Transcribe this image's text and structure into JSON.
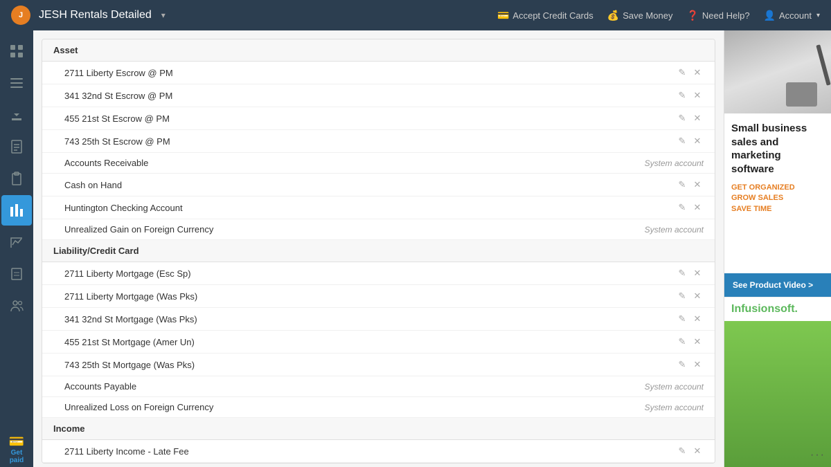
{
  "topnav": {
    "logo_text": "J",
    "title": "JESH Rentals Detailed",
    "dropdown_symbol": "▾",
    "actions": [
      {
        "id": "accept-credit",
        "icon": "💳",
        "label": "Accept Credit Cards"
      },
      {
        "id": "save-money",
        "icon": "💰",
        "label": "Save Money"
      },
      {
        "id": "need-help",
        "icon": "❓",
        "label": "Need Help?"
      },
      {
        "id": "account",
        "icon": "👤",
        "label": "Account",
        "has_dropdown": true
      }
    ]
  },
  "sidebar": {
    "items": [
      {
        "id": "dashboard",
        "icon": "grid",
        "active": false
      },
      {
        "id": "list",
        "icon": "list",
        "active": false
      },
      {
        "id": "download",
        "icon": "download",
        "active": false
      },
      {
        "id": "document",
        "icon": "document",
        "active": false
      },
      {
        "id": "clipboard",
        "icon": "clipboard",
        "active": false
      },
      {
        "id": "chart-active",
        "icon": "chart",
        "active": true
      },
      {
        "id": "bar-chart",
        "icon": "bar",
        "active": false
      },
      {
        "id": "report",
        "icon": "report",
        "active": false
      },
      {
        "id": "people",
        "icon": "people",
        "active": false
      }
    ],
    "get_paid_label": "Get\npaid"
  },
  "sections": [
    {
      "id": "asset",
      "header": "Asset",
      "rows": [
        {
          "id": "r1",
          "name": "2711 Liberty Escrow @ PM",
          "type": "editable"
        },
        {
          "id": "r2",
          "name": "341 32nd St Escrow @ PM",
          "type": "editable"
        },
        {
          "id": "r3",
          "name": "455 21st St Escrow @ PM",
          "type": "editable"
        },
        {
          "id": "r4",
          "name": "743 25th St Escrow @ PM",
          "type": "editable"
        },
        {
          "id": "r5",
          "name": "Accounts Receivable",
          "type": "system"
        },
        {
          "id": "r6",
          "name": "Cash on Hand",
          "type": "editable"
        },
        {
          "id": "r7",
          "name": "Huntington Checking Account",
          "type": "editable"
        },
        {
          "id": "r8",
          "name": "Unrealized Gain on Foreign Currency",
          "type": "system"
        }
      ]
    },
    {
      "id": "liability",
      "header": "Liability/Credit Card",
      "rows": [
        {
          "id": "r9",
          "name": "2711 Liberty Mortgage (Esc Sp)",
          "type": "editable"
        },
        {
          "id": "r10",
          "name": "2711 Liberty Mortgage (Was Pks)",
          "type": "editable"
        },
        {
          "id": "r11",
          "name": "341 32nd St Mortgage (Was Pks)",
          "type": "editable"
        },
        {
          "id": "r12",
          "name": "455 21st St Mortgage (Amer Un)",
          "type": "editable"
        },
        {
          "id": "r13",
          "name": "743 25th St Mortgage (Was Pks)",
          "type": "editable"
        },
        {
          "id": "r14",
          "name": "Accounts Payable",
          "type": "system"
        },
        {
          "id": "r15",
          "name": "Unrealized Loss on Foreign Currency",
          "type": "system"
        }
      ]
    },
    {
      "id": "income",
      "header": "Income",
      "rows": [
        {
          "id": "r16",
          "name": "2711 Liberty Income - Late Fee",
          "type": "editable"
        }
      ]
    }
  ],
  "system_account_label": "System account",
  "ad": {
    "headline": "Small business sales and marketing software",
    "tagline": "GET ORGANIZED\nGROW SALES\nSAVE TIME",
    "product_video_label": "See Product Video >",
    "infusion_label": "Infusionsoft."
  }
}
